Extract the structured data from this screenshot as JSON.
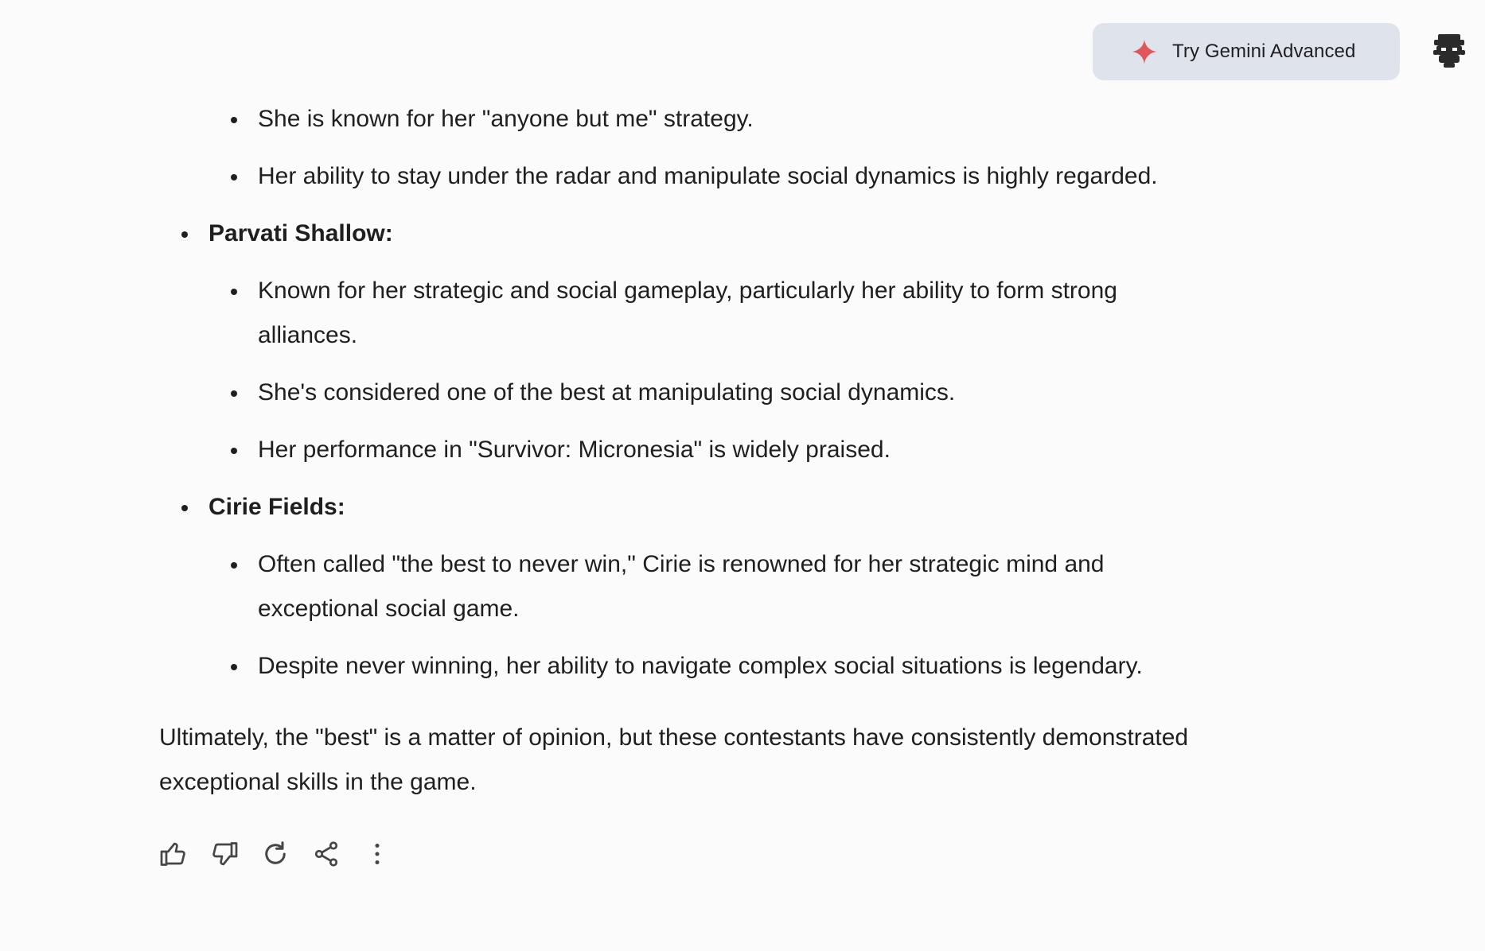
{
  "header": {
    "gemini_button_label": "Try Gemini Advanced"
  },
  "list": {
    "group1_items": [
      "She is known for her \"anyone but me\" strategy.",
      "Her ability to stay under the radar and manipulate social dynamics is highly regarded."
    ],
    "parvati": {
      "name": "Parvati Shallow:",
      "items": [
        "Known for her strategic and social gameplay, particularly her ability to form strong alliances.",
        "She's considered one of the best at manipulating social dynamics.",
        "Her performance in \"Survivor: Micronesia\" is widely praised."
      ]
    },
    "cirie": {
      "name": "Cirie Fields:",
      "items": [
        "Often called \"the best to never win,\" Cirie is renowned for her strategic mind and exceptional social game.",
        "Despite never winning, her ability to navigate complex social situations is legendary."
      ]
    }
  },
  "conclusion": "Ultimately, the \"best\" is a matter of opinion, but these contestants have consistently demonstrated exceptional skills in the game.",
  "actions": {
    "icons": [
      "thumbs-up-icon",
      "thumbs-down-icon",
      "regenerate-icon",
      "share-icon",
      "more-vert-icon"
    ]
  },
  "colors": {
    "background": "#fbfbfc",
    "button_bg": "#dfe4ec",
    "spark": "#e0565b",
    "text": "#1f1f1f"
  }
}
